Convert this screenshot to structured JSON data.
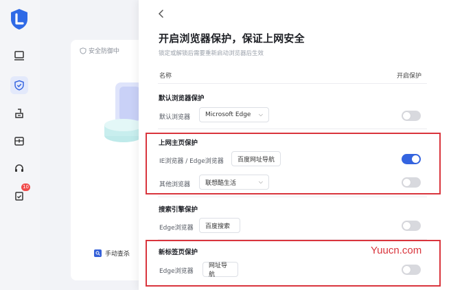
{
  "sidebar": {
    "icons": [
      "logo-icon",
      "computer-icon",
      "shield-icon",
      "broom-icon",
      "toolbox-icon",
      "headset-icon",
      "clipboard-icon"
    ],
    "badge": "10",
    "accent": "#3464e0"
  },
  "background": {
    "status": "安全防御中",
    "scan_button": "手动查杀"
  },
  "panel": {
    "title": "开启浏览器保护，保证上网安全",
    "subtitle": "锁定或解锁后需要重新启动浏览器后生效",
    "col_name": "名称",
    "col_toggle": "开启保护",
    "sections": [
      {
        "title": "默认浏览器保护",
        "rows": [
          {
            "label": "默认浏览器",
            "value": "Microsoft Edge",
            "dropdown": true,
            "enabled": false
          }
        ]
      },
      {
        "title": "上网主页保护",
        "rows": [
          {
            "label": "IE浏览器 / Edge浏览器",
            "value": "百度网址导航",
            "dropdown": false,
            "enabled": true
          },
          {
            "label": "其他浏览器",
            "value": "联想酷生活",
            "dropdown": true,
            "enabled": false
          }
        ]
      },
      {
        "title": "搜索引擎保护",
        "rows": [
          {
            "label": "Edge浏览器",
            "value": "百度搜索",
            "dropdown": false,
            "enabled": false
          }
        ]
      },
      {
        "title": "新标签页保护",
        "rows": [
          {
            "label": "Edge浏览器",
            "value": "网址导航",
            "dropdown": false,
            "enabled": false
          }
        ]
      }
    ]
  },
  "watermark": "Yuucn.com",
  "highlight_color": "#d9343c"
}
